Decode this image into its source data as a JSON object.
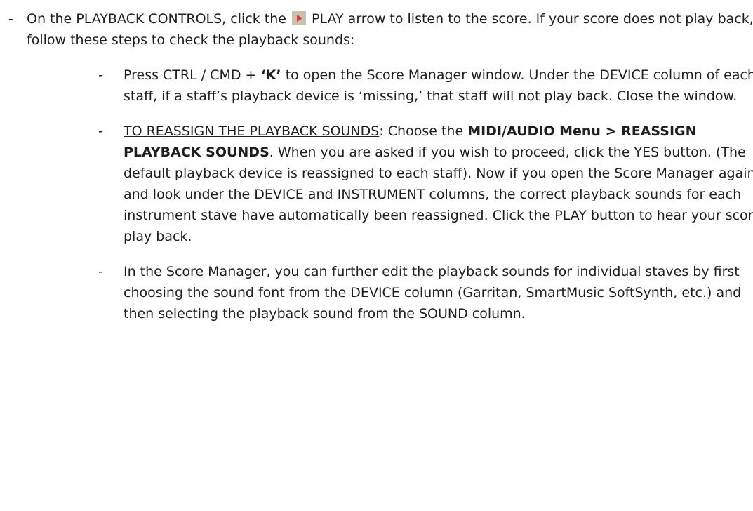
{
  "bullets": {
    "dash": "-"
  },
  "item1": {
    "text_a": "On the PLAYBACK CONTROLS, click the",
    "icon": "play-arrow-icon",
    "text_b": "PLAY arrow to listen to the score. If your score does not play back, follow these steps to check the playback sounds:"
  },
  "item2": {
    "text_a": "Press CTRL / CMD + ",
    "key": "‘K’",
    "text_b": " to open the Score Manager window. Under the DEVICE column of each staff, if a staff’s playback device is ‘missing,’ that staff will not play back. Close the window."
  },
  "item3": {
    "underline": "TO REASSIGN THE PLAYBACK SOUNDS",
    "text_a": ":  Choose the ",
    "menu": "MIDI/AUDIO Menu > REASSIGN PLAYBACK SOUNDS",
    "text_b": ". When you are asked if you wish to proceed, click the YES button. (The default playback device is reassigned to each staff). Now if you open the Score Manager again and look under the DEVICE and INSTRUMENT columns, the correct playback sounds for each instrument stave have automatically been reassigned. Click the PLAY button to hear your score play back."
  },
  "item4": {
    "text": "In the Score Manager, you can further edit the playback sounds for individual staves by first choosing the sound font from the DEVICE column (Garritan, SmartMusic SoftSynth, etc.) and then selecting the playback sound from the SOUND column."
  }
}
